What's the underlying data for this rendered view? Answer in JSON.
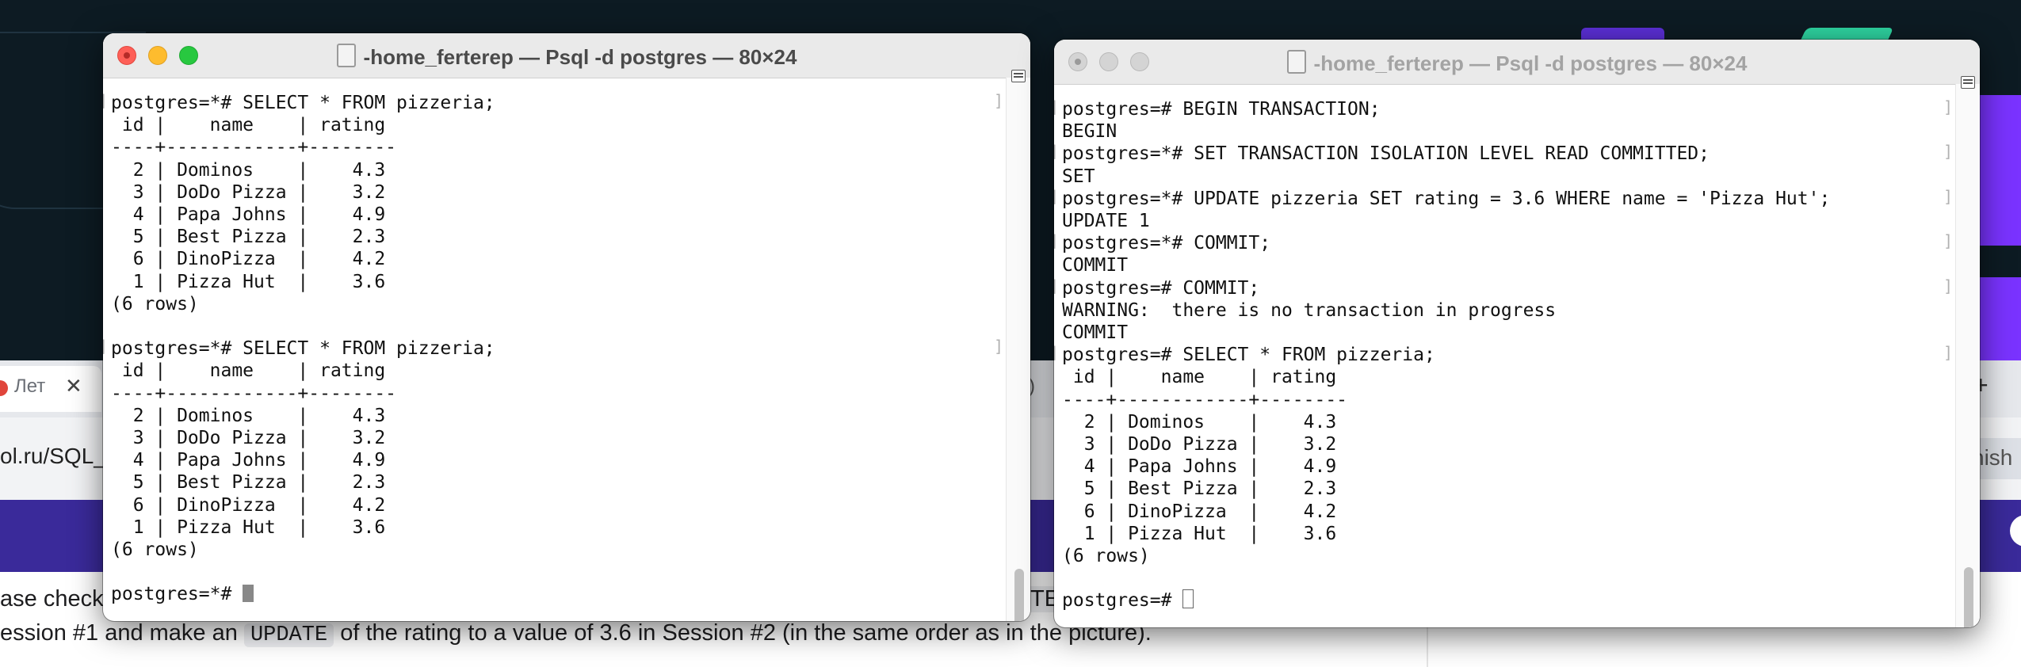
{
  "background_page": {
    "tab": {
      "label": "Лет",
      "close": "✕"
    },
    "right_tab_fragment": ")",
    "new_tab": "+",
    "url": "ol.ru/SQL_",
    "finish_button_fragment": "nish",
    "text_line_1": "ase check",
    "text_line_1_right_fragment": "TE",
    "text_line_2": {
      "before": "ession #1 and make an ",
      "code": "UPDATE",
      "after": " of the rating to a value of 3.6 in Session #2 (in the same order as in the picture)."
    }
  },
  "terminal_left": {
    "title": "-home_ferterep — Psql -d postgres — 80×24",
    "lines": [
      "postgres=*# SELECT * FROM pizzeria;",
      " id |    name    | rating",
      "----+------------+--------",
      "  2 | Dominos    |    4.3",
      "  3 | DoDo Pizza |    3.2",
      "  4 | Papa Johns |    4.9",
      "  5 | Best Pizza |    2.3",
      "  6 | DinoPizza  |    4.2",
      "  1 | Pizza Hut  |    3.6",
      "(6 rows)",
      "",
      "postgres=*# SELECT * FROM pizzeria;",
      " id |    name    | rating",
      "----+------------+--------",
      "  2 | Dominos    |    4.3",
      "  3 | DoDo Pizza |    3.2",
      "  4 | Papa Johns |    4.9",
      "  5 | Best Pizza |    2.3",
      "  6 | DinoPizza  |    4.2",
      "  1 | Pizza Hut  |    3.6",
      "(6 rows)",
      ""
    ],
    "prompt": "postgres=*# "
  },
  "terminal_right": {
    "title": "-home_ferterep — Psql -d postgres — 80×24",
    "lines": [
      "postgres=# BEGIN TRANSACTION;",
      "BEGIN",
      "postgres=*# SET TRANSACTION ISOLATION LEVEL READ COMMITTED;",
      "SET",
      "postgres=*# UPDATE pizzeria SET rating = 3.6 WHERE name = 'Pizza Hut';",
      "UPDATE 1",
      "postgres=*# COMMIT;",
      "COMMIT",
      "postgres=# COMMIT;",
      "WARNING:  there is no transaction in progress",
      "COMMIT",
      "postgres=# SELECT * FROM pizzeria;",
      " id |    name    | rating",
      "----+------------+--------",
      "  2 | Dominos    |    4.3",
      "  3 | DoDo Pizza |    3.2",
      "  4 | Papa Johns |    4.9",
      "  5 | Best Pizza |    2.3",
      "  6 | DinoPizza  |    4.2",
      "  1 | Pizza Hut  |    3.6",
      "(6 rows)",
      ""
    ],
    "prompt": "postgres=# "
  }
}
